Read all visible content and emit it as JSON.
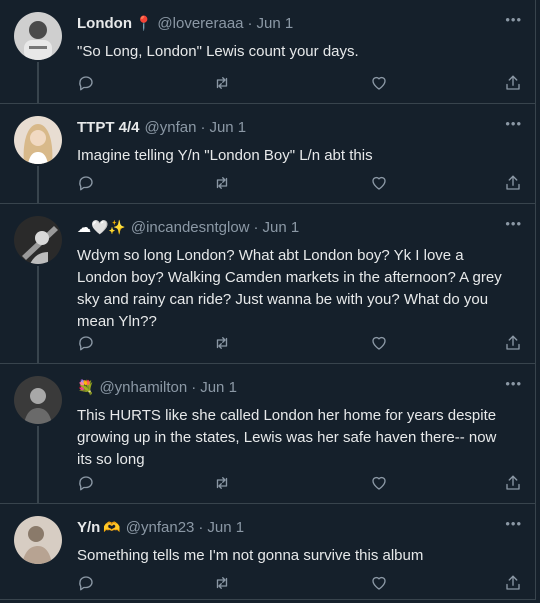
{
  "tweets": [
    {
      "name": "London",
      "name_emoji": "📍",
      "handle": "@lovereraaa",
      "date": "Jun 1",
      "text": "\"So Long, London\" Lewis count your days."
    },
    {
      "name": "TTPT 4/4",
      "name_emoji": "",
      "handle": "@ynfan",
      "date": "Jun 1",
      "text": "Imagine telling Y/n \"London Boy\" L/n abt this"
    },
    {
      "name": "",
      "name_emoji": "☁🤍✨",
      "handle": "@incandesntglow",
      "date": "Jun 1",
      "text": "Wdym so long London? What abt London boy? Yk I love a London boy? Walking Camden markets in the afternoon? A grey sky and rainy can ride? Just wanna be with you? What do you mean Yln??"
    },
    {
      "name": "",
      "name_emoji": "💐",
      "handle": "@ynhamilton",
      "date": "Jun 1",
      "text": "This HURTS like she called London her home for years despite growing up in the states, Lewis was her safe haven there-- now its so long"
    },
    {
      "name": "Y/n",
      "name_emoji": "🫶",
      "handle": "@ynfan23",
      "date": "Jun 1",
      "text": "Something tells me I'm not gonna survive this album"
    }
  ],
  "separator": "·",
  "more_label": "•••",
  "icons": [
    "reply-icon",
    "retweet-icon",
    "like-icon",
    "share-icon"
  ],
  "colors": {
    "background": "#15202b",
    "text": "#e7e9ea",
    "muted": "#8b98a5",
    "divider": "#38444d",
    "pin": "#f4212e",
    "sparkle": "#ffd21f"
  }
}
